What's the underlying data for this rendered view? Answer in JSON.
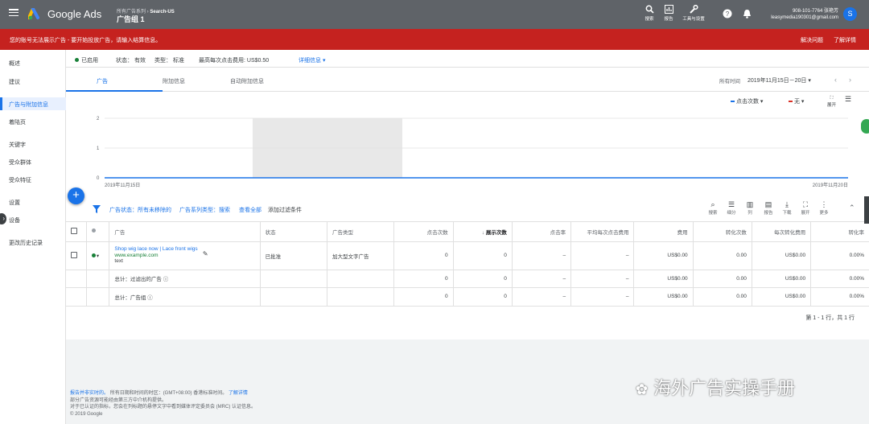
{
  "app": {
    "brand": "Google Ads",
    "crumb_parent": "所有广告系列",
    "crumb_child": "Search-US",
    "campaign": "广告组 1"
  },
  "top_tools": [
    "搜索",
    "报告",
    "工具与设置"
  ],
  "account": {
    "phone": "908-101-7764 张艳芳",
    "email": "leasymedia190301@gmail.com",
    "avatar": "S"
  },
  "alert": {
    "message": "您的账号无法展示广告 - 要开始投放广告，请输入结算信息。",
    "dismiss": "解决问题",
    "learn": "了解详情"
  },
  "sidebar": [
    "概述",
    "建议",
    "广告与附加信息",
    "着陆页",
    "关键字",
    "受众群体",
    "受众特征",
    "设置",
    "设备",
    "更改历史记录"
  ],
  "status_bar": {
    "enabled": "已启用",
    "status": "状态： 有效",
    "type": "类型： 标准",
    "max_cpc": "最高每次点击费用: US$0.50",
    "details": "详细信息"
  },
  "tabs": [
    "广告",
    "附加信息",
    "自动附加信息"
  ],
  "date": {
    "label": "所有时间",
    "range": "2019年11月15日－20日"
  },
  "chart": {
    "metric1": "点击次数",
    "metric2": "无",
    "expand": "展开",
    "ticks": [
      "2",
      "1",
      "0"
    ],
    "date_start": "2019年11月15日",
    "date_end": "2019年11月20日"
  },
  "chart_data": {
    "type": "line",
    "x": [
      "2019-11-15",
      "2019-11-20"
    ],
    "series": [
      {
        "name": "点击次数",
        "values": [
          0,
          0
        ]
      }
    ],
    "ylim": [
      0,
      2
    ]
  },
  "filter": {
    "text": "广告状态：所有未移除的",
    "type": "广告系列类型：搜索",
    "view_all": "查看全部",
    "add": "添加过滤条件"
  },
  "table_tools": [
    "搜索",
    "细分",
    "列",
    "报告",
    "下载",
    "展开",
    "更多"
  ],
  "columns": [
    "广告",
    "状态",
    "广告类型",
    "点击次数",
    "展示次数",
    "点击率",
    "平均每次点击费用",
    "费用",
    "转化次数",
    "每次转化费用",
    "转化率"
  ],
  "ad": {
    "headline": "Shop wig lace now | Lace front wigs",
    "url": "www.example.com",
    "desc": "text",
    "status": "已批准",
    "type": "加大型文字广告",
    "clicks": "0",
    "impr": "0",
    "ctr": "–",
    "cpc": "–",
    "cost": "US$0.00",
    "conv": "0.00",
    "cpa": "US$0.00",
    "rate": "0.00%"
  },
  "totals": [
    {
      "label": "总计：过滤出的广告",
      "clicks": "0",
      "impr": "0",
      "ctr": "–",
      "cpc": "–",
      "cost": "US$0.00",
      "conv": "0.00",
      "cpa": "US$0.00",
      "rate": "0.00%"
    },
    {
      "label": "总计：广告组",
      "clicks": "0",
      "impr": "0",
      "ctr": "–",
      "cpc": "–",
      "cost": "US$0.00",
      "conv": "0.00",
      "cpa": "US$0.00",
      "rate": "0.00%"
    }
  ],
  "pagination": "第 1 - 1 行，共 1 行",
  "footer": {
    "line1a": "报告并非实时的。",
    "line1b": "所有日期和时间的时区：(GMT+08:00) 香港标准时间。",
    "line1c": "了解详情",
    "line2": "部分广告资源可能经由第三方中介机构提供。",
    "line3": "对于已认证的指标，您会在列标题的悬停文字中看到媒体评定委员会 (MRC) 认证信息。",
    "line4": "© 2019 Google"
  },
  "watermark": "海外广告实操手册",
  "colors": {
    "blue": "#1a73e8",
    "alert": "#c5221f",
    "header": "#5f6368",
    "red": "#d93025"
  }
}
